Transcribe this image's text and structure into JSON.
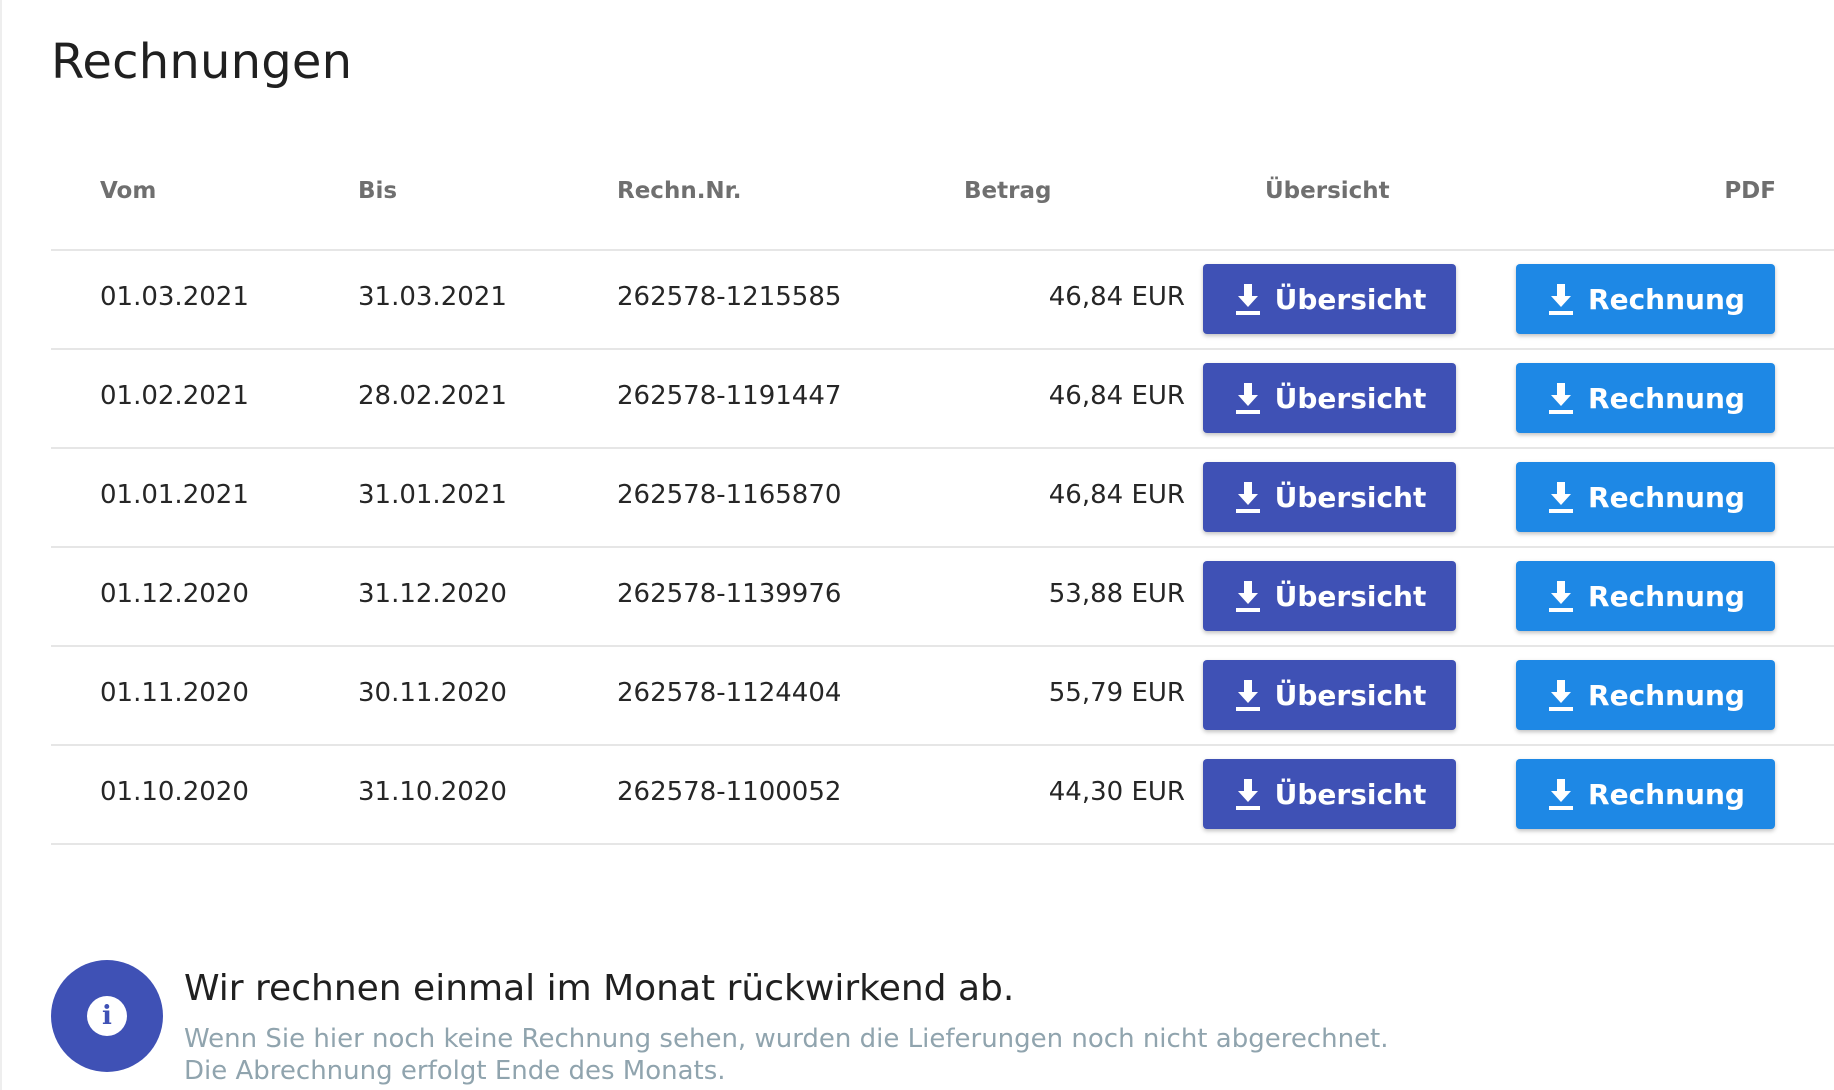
{
  "page": {
    "title": "Rechnungen"
  },
  "table": {
    "headers": {
      "vom": "Vom",
      "bis": "Bis",
      "nr": "Rechn.Nr.",
      "betrag": "Betrag",
      "uebersicht": "Übersicht",
      "pdf": "PDF"
    },
    "rows": [
      {
        "vom": "01.03.2021",
        "bis": "31.03.2021",
        "nr": "262578-1215585",
        "betrag": "46,84 EUR",
        "btn_ueb": "Übersicht",
        "btn_pdf": "Rechnung"
      },
      {
        "vom": "01.02.2021",
        "bis": "28.02.2021",
        "nr": "262578-1191447",
        "betrag": "46,84 EUR",
        "btn_ueb": "Übersicht",
        "btn_pdf": "Rechnung"
      },
      {
        "vom": "01.01.2021",
        "bis": "31.01.2021",
        "nr": "262578-1165870",
        "betrag": "46,84 EUR",
        "btn_ueb": "Übersicht",
        "btn_pdf": "Rechnung"
      },
      {
        "vom": "01.12.2020",
        "bis": "31.12.2020",
        "nr": "262578-1139976",
        "betrag": "53,88 EUR",
        "btn_ueb": "Übersicht",
        "btn_pdf": "Rechnung"
      },
      {
        "vom": "01.11.2020",
        "bis": "30.11.2020",
        "nr": "262578-1124404",
        "betrag": "55,79 EUR",
        "btn_ueb": "Übersicht",
        "btn_pdf": "Rechnung"
      },
      {
        "vom": "01.10.2020",
        "bis": "31.10.2020",
        "nr": "262578-1100052",
        "betrag": "44,30 EUR",
        "btn_ueb": "Übersicht",
        "btn_pdf": "Rechnung"
      }
    ]
  },
  "info": {
    "icon": "info-icon",
    "title": "Wir rechnen einmal im Monat rückwirkend ab.",
    "line1": "Wenn Sie hier noch keine Rechnung sehen, wurden die Lieferungen noch nicht abgerechnet.",
    "line2": "Die Abrechnung erfolgt Ende des Monats."
  },
  "colors": {
    "primary": "#3f51b5",
    "accent": "#1e88e5",
    "muted_text": "#90a4ae"
  }
}
